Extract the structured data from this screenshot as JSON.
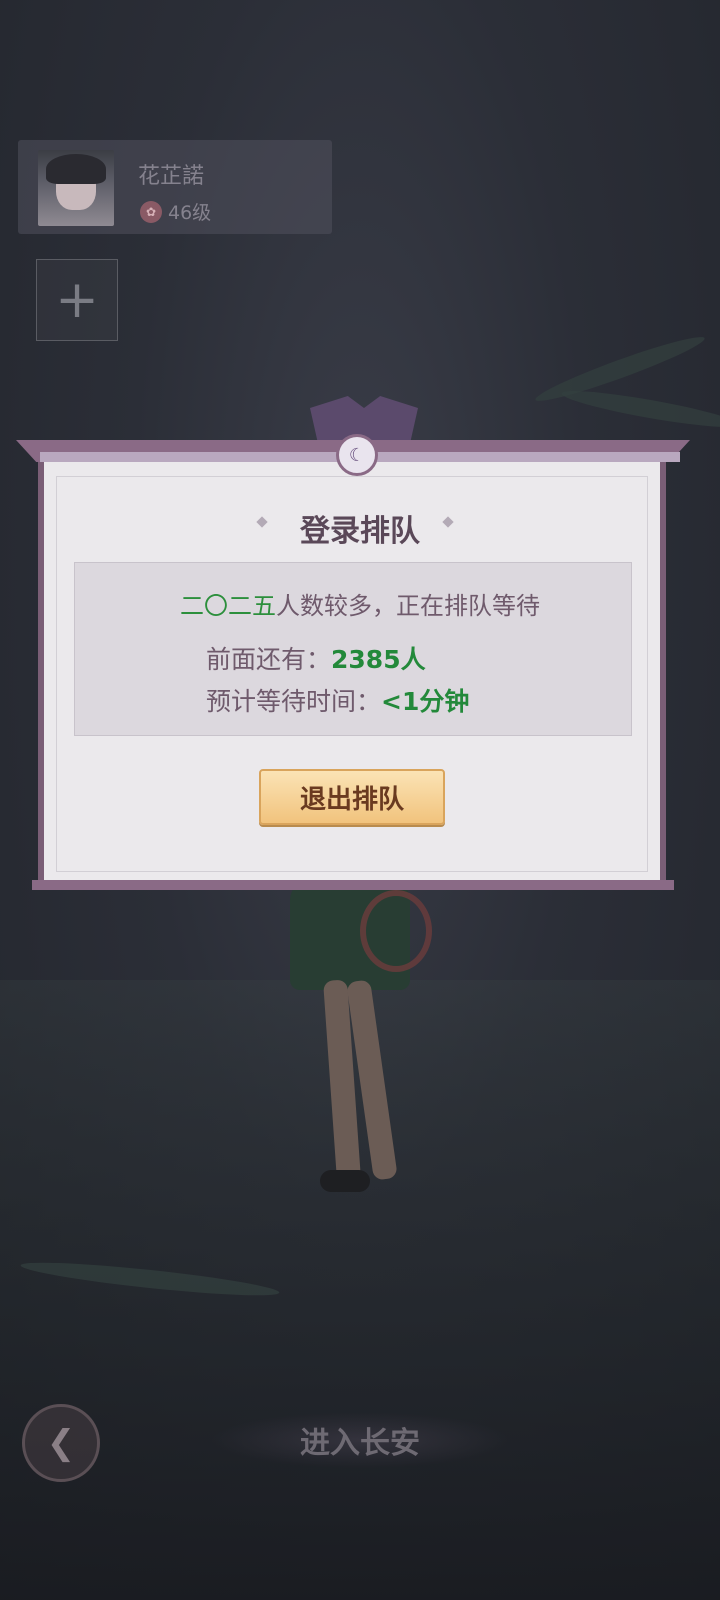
{
  "character": {
    "name": "花芷諾",
    "level": "46级"
  },
  "add_button": {
    "icon": "plus-icon",
    "glyph": "+"
  },
  "queue_dialog": {
    "emblem_glyph": "☾",
    "title": "登录排队",
    "message_highlight": "二〇二五",
    "message_rest": "人数较多，正在排队等待",
    "ahead_label": "前面还有：",
    "ahead_value": "2385人",
    "wait_label": "预计等待时间：",
    "wait_value": "<1分钟",
    "exit_label": "退出排队"
  },
  "bottom_nav": {
    "back_icon": "back-arrow-icon",
    "back_glyph": "❮",
    "enter_label": "进入长安"
  },
  "colors": {
    "accent_green": "#23893a",
    "dialog_frame": "#7a5e76",
    "button_gold": "#f1c37d"
  }
}
